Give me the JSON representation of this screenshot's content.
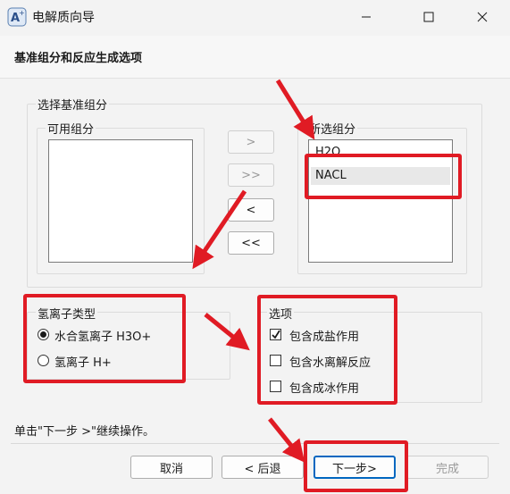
{
  "window": {
    "title": "电解质向导",
    "minimize_glyph": "—",
    "maximize_glyph": "☐",
    "close_glyph": "✕"
  },
  "header": {
    "title": "基准组分和反应生成选项"
  },
  "base_group": {
    "label": "选择基准组分",
    "available_label": "可用组分",
    "available_items": [],
    "selected_label": "所选组分",
    "selected_items": [
      "H2O",
      "NACL"
    ],
    "highlighted_index": 1
  },
  "transfer_buttons": {
    "add": ">",
    "add_all": ">>",
    "remove": "<",
    "remove_all": "<<"
  },
  "hydrogen_ion": {
    "label": "氢离子类型",
    "options": [
      "水合氢离子 H3O+",
      "氢离子 H+"
    ],
    "selected_index": 0
  },
  "options": {
    "label": "选项",
    "items": [
      "包含成盐作用",
      "包含水离解反应",
      "包含成冰作用"
    ],
    "checked": [
      true,
      false,
      false
    ]
  },
  "instruction": "单击\"下一步 >\"继续操作。",
  "footer": {
    "cancel": "取消",
    "back": "< 后退",
    "next": "下一步>",
    "finish": "完成"
  },
  "colors": {
    "annotation": "#e01b24",
    "focus": "#0067c0"
  }
}
